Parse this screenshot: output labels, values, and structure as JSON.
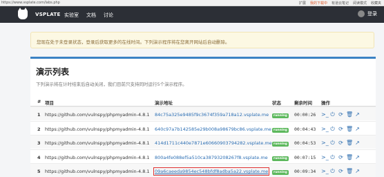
{
  "browser": {
    "address": "https://www.vsplate.com/labs.php",
    "tools": [
      "扩展",
      "我的下载中",
      "有道云笔记",
      "阅读模式",
      "收藏夹"
    ]
  },
  "nav": {
    "brand": "VSPLATE",
    "items": [
      "实验室",
      "文档",
      "讨论"
    ],
    "login": "登录"
  },
  "alert": "您现在处于未登录状态，登录后获取更多的在线时间。下列演示程序将在您离开网站后自动删除。",
  "panel": {
    "title": "演示列表",
    "subtitle": "下列演示将在计时结束后自动关闭，我们目前只支持同时运行5个演示程序。",
    "headers": {
      "num": "#",
      "project": "项目",
      "url": "演示地址",
      "status": "状态",
      "time": "剩余时间",
      "ops": "操作"
    },
    "rows": [
      {
        "num": "1",
        "project": "https://github.com/vulnspy/phpmyadmin-4.8.1",
        "url": "84c75a325e9485f9c3674f359a718a12.vsplate.me",
        "status": "running",
        "time": "00:00:26"
      },
      {
        "num": "2",
        "project": "https://github.com/vulnspy/phpmyadmin-4.8.1",
        "url": "640c97a7b142585e29b008a98679bc86.vsplate.me",
        "status": "running",
        "time": "00:04:43"
      },
      {
        "num": "3",
        "project": "https://github.com/vulnspy/phpmyadmin-4.8.1",
        "url": "414d1711c440e7871e60660903794282.vsplate.me",
        "status": "running",
        "time": "00:04:53"
      },
      {
        "num": "4",
        "project": "https://github.com/vulnspy/phpmyadmin-4.8.1",
        "url": "800a4fe088ef5a510ca38793208267f8.vsplate.me",
        "status": "running",
        "time": "00:07:15"
      },
      {
        "num": "5",
        "project": "https://github.com/vulnspy/phpmyadmin-4.8.1",
        "url": "09a6caeeda9854ec548bfdf8adba5a22.vsplate.me",
        "status": "running",
        "time": "00:09:34"
      }
    ],
    "ops_icons": [
      "terminal-icon",
      "power-icon",
      "refresh-icon",
      "delete-icon",
      "open-external-icon"
    ]
  },
  "colors": {
    "accent": "#3b82c4",
    "running": "#5cb85c",
    "link": "#2a6db3",
    "highlight": "#e03030"
  }
}
